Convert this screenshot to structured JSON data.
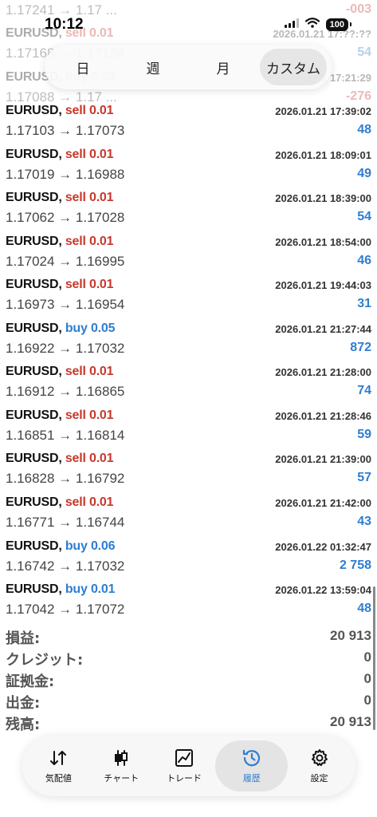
{
  "status_bar": {
    "time": "10:12",
    "battery": "100"
  },
  "period_tabs": [
    {
      "label": "日",
      "active": false
    },
    {
      "label": "週",
      "active": false
    },
    {
      "label": "月",
      "active": false
    },
    {
      "label": "カスタム",
      "active": true
    }
  ],
  "trades": [
    {
      "symbol": "EURUSD,",
      "side": "sell",
      "volume": "sell 0.01",
      "time": "2026.01.21 17:??:??",
      "prices": "1.17241 → 1.17 ...",
      "profit": "-003",
      "faded": true
    },
    {
      "symbol": "EURUSD,",
      "side": "sell",
      "volume": "sell 0.01",
      "time": "2026.01.21 17:??:??",
      "prices": "1.17168 → 1.17134",
      "profit": "54",
      "faded": true
    },
    {
      "symbol": "EURUSD,",
      "side": "buy",
      "volume": "buy 0.03",
      "time": "2026.01.21 17:21:29",
      "prices": "1.17088 → 1.17 ...",
      "profit": "-276",
      "faded": true
    },
    {
      "symbol": "EURUSD,",
      "side": "sell",
      "volume": "sell 0.01",
      "time": "2026.01.21 17:39:02",
      "prices": "1.17103 → 1.17073",
      "profit": "48",
      "faded": false
    },
    {
      "symbol": "EURUSD,",
      "side": "sell",
      "volume": "sell 0.01",
      "time": "2026.01.21 18:09:01",
      "prices": "1.17019 → 1.16988",
      "profit": "49",
      "faded": false
    },
    {
      "symbol": "EURUSD,",
      "side": "sell",
      "volume": "sell 0.01",
      "time": "2026.01.21 18:39:00",
      "prices": "1.17062 → 1.17028",
      "profit": "54",
      "faded": false
    },
    {
      "symbol": "EURUSD,",
      "side": "sell",
      "volume": "sell 0.01",
      "time": "2026.01.21 18:54:00",
      "prices": "1.17024 → 1.16995",
      "profit": "46",
      "faded": false
    },
    {
      "symbol": "EURUSD,",
      "side": "sell",
      "volume": "sell 0.01",
      "time": "2026.01.21 19:44:03",
      "prices": "1.16973 → 1.16954",
      "profit": "31",
      "faded": false
    },
    {
      "symbol": "EURUSD,",
      "side": "buy",
      "volume": "buy 0.05",
      "time": "2026.01.21 21:27:44",
      "prices": "1.16922 → 1.17032",
      "profit": "872",
      "faded": false
    },
    {
      "symbol": "EURUSD,",
      "side": "sell",
      "volume": "sell 0.01",
      "time": "2026.01.21 21:28:00",
      "prices": "1.16912 → 1.16865",
      "profit": "74",
      "faded": false
    },
    {
      "symbol": "EURUSD,",
      "side": "sell",
      "volume": "sell 0.01",
      "time": "2026.01.21 21:28:46",
      "prices": "1.16851 → 1.16814",
      "profit": "59",
      "faded": false
    },
    {
      "symbol": "EURUSD,",
      "side": "sell",
      "volume": "sell 0.01",
      "time": "2026.01.21 21:39:00",
      "prices": "1.16828 → 1.16792",
      "profit": "57",
      "faded": false
    },
    {
      "symbol": "EURUSD,",
      "side": "sell",
      "volume": "sell 0.01",
      "time": "2026.01.21 21:42:00",
      "prices": "1.16771 → 1.16744",
      "profit": "43",
      "faded": false
    },
    {
      "symbol": "EURUSD,",
      "side": "buy",
      "volume": "buy 0.06",
      "time": "2026.01.22 01:32:47",
      "prices": "1.16742 → 1.17032",
      "profit": "2 758",
      "faded": false
    },
    {
      "symbol": "EURUSD,",
      "side": "buy",
      "volume": "buy 0.01",
      "time": "2026.01.22 13:59:04",
      "prices": "1.17042 → 1.17072",
      "profit": "48",
      "faded": false
    }
  ],
  "summary": [
    {
      "label": "損益:",
      "value": "20 913"
    },
    {
      "label": "クレジット:",
      "value": "0"
    },
    {
      "label": "証拠金:",
      "value": "0"
    },
    {
      "label": "出金:",
      "value": "0"
    },
    {
      "label": "残高:",
      "value": "20 913"
    }
  ],
  "tab_bar": [
    {
      "label": "気配値",
      "icon": "arrows-updown-icon",
      "active": false
    },
    {
      "label": "チャート",
      "icon": "candlestick-icon",
      "active": false
    },
    {
      "label": "トレード",
      "icon": "trend-chart-icon",
      "active": false
    },
    {
      "label": "履歴",
      "icon": "history-clock-icon",
      "active": true
    },
    {
      "label": "設定",
      "icon": "gear-icon",
      "active": false
    }
  ],
  "colors": {
    "sell": "#c8382c",
    "buy": "#2f7dd1",
    "profit_positive": "#2f7dd1",
    "profit_negative": "#c8382c"
  }
}
